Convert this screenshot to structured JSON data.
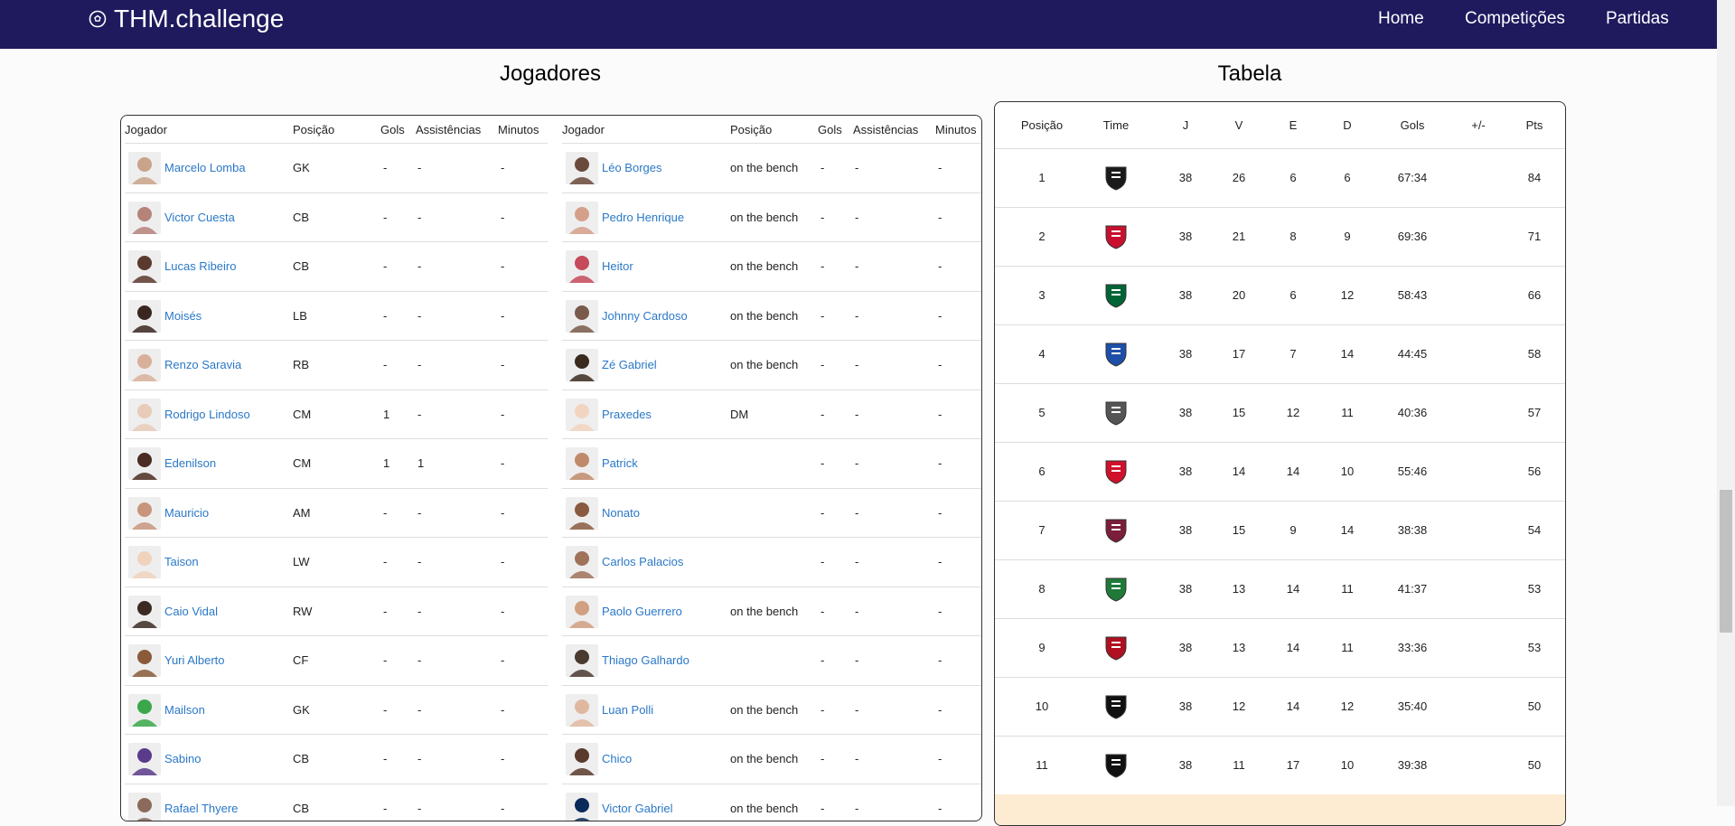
{
  "nav": {
    "brand": "THM.challenge",
    "links": [
      "Home",
      "Competições",
      "Partidas"
    ]
  },
  "players": {
    "title": "Jogadores",
    "headers": [
      "Jogador",
      "Posição",
      "Gols",
      "Assistências",
      "Minutos"
    ],
    "left": [
      {
        "name": "Marcelo Lomba",
        "pos": "GK",
        "gols": "-",
        "ast": "-",
        "min": "-"
      },
      {
        "name": "Victor Cuesta",
        "pos": "CB",
        "gols": "-",
        "ast": "-",
        "min": "-"
      },
      {
        "name": "Lucas Ribeiro",
        "pos": "CB",
        "gols": "-",
        "ast": "-",
        "min": "-"
      },
      {
        "name": "Moisés",
        "pos": "LB",
        "gols": "-",
        "ast": "-",
        "min": "-"
      },
      {
        "name": "Renzo Saravia",
        "pos": "RB",
        "gols": "-",
        "ast": "-",
        "min": "-"
      },
      {
        "name": "Rodrigo Lindoso",
        "pos": "CM",
        "gols": "1",
        "ast": "-",
        "min": "-"
      },
      {
        "name": "Edenilson",
        "pos": "CM",
        "gols": "1",
        "ast": "1",
        "min": "-"
      },
      {
        "name": "Mauricio",
        "pos": "AM",
        "gols": "-",
        "ast": "-",
        "min": "-"
      },
      {
        "name": "Taison",
        "pos": "LW",
        "gols": "-",
        "ast": "-",
        "min": "-"
      },
      {
        "name": "Caio Vidal",
        "pos": "RW",
        "gols": "-",
        "ast": "-",
        "min": "-"
      },
      {
        "name": "Yuri Alberto",
        "pos": "CF",
        "gols": "-",
        "ast": "-",
        "min": "-"
      },
      {
        "name": "Mailson",
        "pos": "GK",
        "gols": "-",
        "ast": "-",
        "min": "-"
      },
      {
        "name": "Sabino",
        "pos": "CB",
        "gols": "-",
        "ast": "-",
        "min": "-"
      },
      {
        "name": "Rafael Thyere",
        "pos": "CB",
        "gols": "-",
        "ast": "-",
        "min": "-"
      }
    ],
    "right": [
      {
        "name": "Léo Borges",
        "pos": "on the bench",
        "gols": "-",
        "ast": "-",
        "min": "-"
      },
      {
        "name": "Pedro Henrique",
        "pos": "on the bench",
        "gols": "-",
        "ast": "-",
        "min": "-"
      },
      {
        "name": "Heitor",
        "pos": "on the bench",
        "gols": "-",
        "ast": "-",
        "min": "-"
      },
      {
        "name": "Johnny Cardoso",
        "pos": "on the bench",
        "gols": "-",
        "ast": "-",
        "min": "-"
      },
      {
        "name": "Zé Gabriel",
        "pos": "on the bench",
        "gols": "-",
        "ast": "-",
        "min": "-"
      },
      {
        "name": "Praxedes",
        "pos": "DM",
        "gols": "-",
        "ast": "-",
        "min": "-"
      },
      {
        "name": "Patrick",
        "pos": "",
        "gols": "-",
        "ast": "-",
        "min": "-"
      },
      {
        "name": "Nonato",
        "pos": "",
        "gols": "-",
        "ast": "-",
        "min": "-"
      },
      {
        "name": "Carlos Palacios",
        "pos": "",
        "gols": "-",
        "ast": "-",
        "min": "-"
      },
      {
        "name": "Paolo Guerrero",
        "pos": "on the bench",
        "gols": "-",
        "ast": "-",
        "min": "-"
      },
      {
        "name": "Thiago Galhardo",
        "pos": "",
        "gols": "-",
        "ast": "-",
        "min": "-"
      },
      {
        "name": "Luan Polli",
        "pos": "on the bench",
        "gols": "-",
        "ast": "-",
        "min": "-"
      },
      {
        "name": "Chico",
        "pos": "on the bench",
        "gols": "-",
        "ast": "-",
        "min": "-"
      },
      {
        "name": "Victor Gabriel",
        "pos": "on the bench",
        "gols": "-",
        "ast": "-",
        "min": "-"
      }
    ],
    "avatar_colors": [
      "#c9a38a",
      "#b5837a",
      "#5a3a2e",
      "#3a2620",
      "#d8b09a",
      "#e8cbb8",
      "#4a2c20",
      "#c8957c",
      "#f0d2bd",
      "#3c2a22",
      "#8a5a3a",
      "#3aa84a",
      "#5a3a8a",
      "#8a6a5a",
      "#6a4a3a",
      "#d4a08a",
      "#c64a5a",
      "#7a5a4a",
      "#3a2a1e",
      "#f2d4c0",
      "#c08a6a",
      "#8a5a40",
      "#a0725a",
      "#d0a080",
      "#4a3a30",
      "#e0b8a0",
      "#5a3a2a",
      "#0a2a5a"
    ]
  },
  "standings": {
    "title": "Tabela",
    "headers": [
      "Posição",
      "Time",
      "J",
      "V",
      "E",
      "D",
      "Gols",
      "+/-",
      "Pts"
    ],
    "rows": [
      {
        "pos": "1",
        "crest": "#1a1a1a",
        "j": "38",
        "v": "26",
        "e": "6",
        "d": "6",
        "gols": "67:34",
        "diff": "",
        "pts": "84"
      },
      {
        "pos": "2",
        "crest": "#c8102e",
        "j": "38",
        "v": "21",
        "e": "8",
        "d": "9",
        "gols": "69:36",
        "diff": "",
        "pts": "71"
      },
      {
        "pos": "3",
        "crest": "#006437",
        "j": "38",
        "v": "20",
        "e": "6",
        "d": "12",
        "gols": "58:43",
        "diff": "",
        "pts": "66"
      },
      {
        "pos": "4",
        "crest": "#1e4fa8",
        "j": "38",
        "v": "17",
        "e": "7",
        "d": "14",
        "gols": "44:45",
        "diff": "",
        "pts": "58"
      },
      {
        "pos": "5",
        "crest": "#555555",
        "j": "38",
        "v": "15",
        "e": "12",
        "d": "11",
        "gols": "40:36",
        "diff": "",
        "pts": "57"
      },
      {
        "pos": "6",
        "crest": "#d0112b",
        "j": "38",
        "v": "14",
        "e": "14",
        "d": "10",
        "gols": "55:46",
        "diff": "",
        "pts": "56"
      },
      {
        "pos": "7",
        "crest": "#7a1e3a",
        "j": "38",
        "v": "15",
        "e": "9",
        "d": "14",
        "gols": "38:38",
        "diff": "",
        "pts": "54"
      },
      {
        "pos": "8",
        "crest": "#1f7a3a",
        "j": "38",
        "v": "13",
        "e": "14",
        "d": "11",
        "gols": "41:37",
        "diff": "",
        "pts": "53"
      },
      {
        "pos": "9",
        "crest": "#b01020",
        "j": "38",
        "v": "13",
        "e": "14",
        "d": "11",
        "gols": "33:36",
        "diff": "",
        "pts": "53"
      },
      {
        "pos": "10",
        "crest": "#111111",
        "j": "38",
        "v": "12",
        "e": "14",
        "d": "12",
        "gols": "35:40",
        "diff": "",
        "pts": "50"
      },
      {
        "pos": "11",
        "crest": "#111111",
        "j": "38",
        "v": "11",
        "e": "17",
        "d": "10",
        "gols": "39:38",
        "diff": "",
        "pts": "50"
      }
    ]
  }
}
